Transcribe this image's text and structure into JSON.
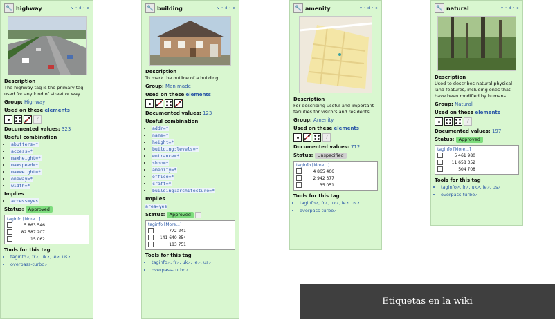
{
  "banner": "Etiquetas en la wiki",
  "vde": "v • d • e",
  "labels": {
    "description": "Description",
    "group": "Group:",
    "used_on_these": "Used on these",
    "elements": "elements",
    "documented_values": "Documented values:",
    "useful_combination": "Useful combination",
    "implies": "Implies",
    "status": "Status:",
    "tools": "Tools for this tag",
    "taginfo_more": "[More...]"
  },
  "cards": {
    "highway": {
      "name": "highway",
      "description": "The highway tag is the primary tag used for any kind of street or way.",
      "group": "Highway",
      "documented_values": "323",
      "combination": [
        "abutters=*",
        "access=*",
        "maxheight=*",
        "maxspeed=*",
        "maxweight=*",
        "oneway=*",
        "width=*"
      ],
      "implies": "access=yes",
      "status": "Approved",
      "taginfo": [
        "5 863 546",
        "82 587 207",
        "15 062"
      ]
    },
    "building": {
      "name": "building",
      "description": "To mark the outline of a building.",
      "group": "Man made",
      "documented_values": "123",
      "combination": [
        "addr=*",
        "name=*",
        "height=*",
        "building:levels=*",
        "entrance=*",
        "shop=*",
        "amenity=*",
        "office=*",
        "craft=*",
        "building:architecture=*"
      ],
      "implies": "area=yes",
      "status": "Approved",
      "taginfo": [
        "772 241",
        "141 640 354",
        "183 751"
      ]
    },
    "amenity": {
      "name": "amenity",
      "description": "For describing useful and important facilities for visitors and residents.",
      "group": "Amenity",
      "documented_values": "712",
      "status": "Unspecified",
      "taginfo": [
        "4 865 406",
        "2 942 377",
        "35 051"
      ]
    },
    "natural": {
      "name": "natural",
      "description": "Used to describes natural physical land features, including ones that have been modified by humans.",
      "group": "Natural",
      "documented_values": "197",
      "status": "Approved",
      "taginfo": [
        "5 461 980",
        "11 658 352",
        "504 708"
      ]
    }
  },
  "tools": {
    "line1": [
      "taginfo",
      "fr",
      "uk",
      "ie",
      "us"
    ],
    "line2": "overpass-turbo"
  }
}
